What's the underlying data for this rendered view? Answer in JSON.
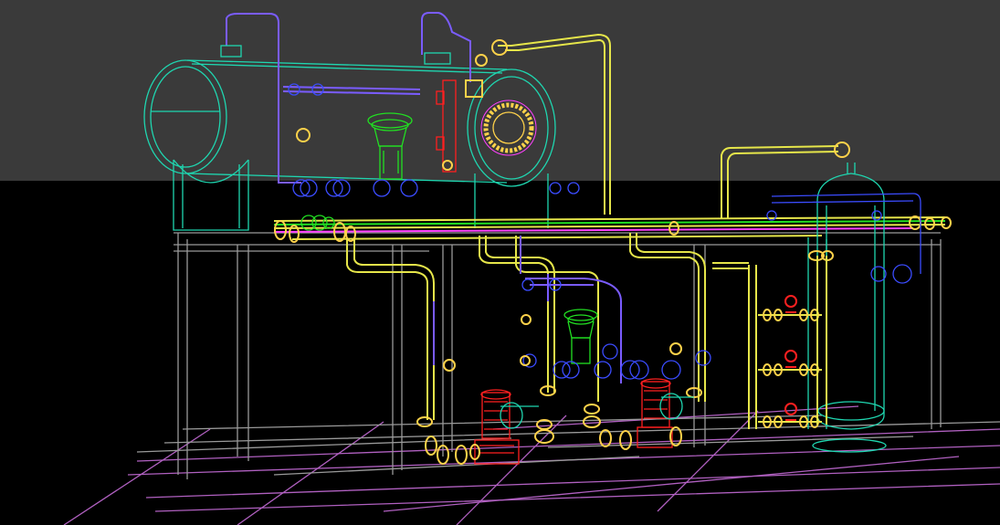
{
  "scene": {
    "background_top": "#3a3a3a",
    "background_bottom": "#000000",
    "colors": {
      "vessel": "#1fd6b0",
      "pipe_main": "#e6e64a",
      "pipe_violet": "#7a5cff",
      "frame": "#9a9a9a",
      "floor": "#b060c0",
      "valve_green": "#22e022",
      "valve_red": "#ff2020",
      "flange_blue": "#3b4cff",
      "accent_magenta": "#ff40ff"
    },
    "icons": [
      "horizontal-separator-icon",
      "vertical-scrubber-icon",
      "control-valve-icon",
      "pump-icon",
      "manway-flange-icon"
    ]
  }
}
